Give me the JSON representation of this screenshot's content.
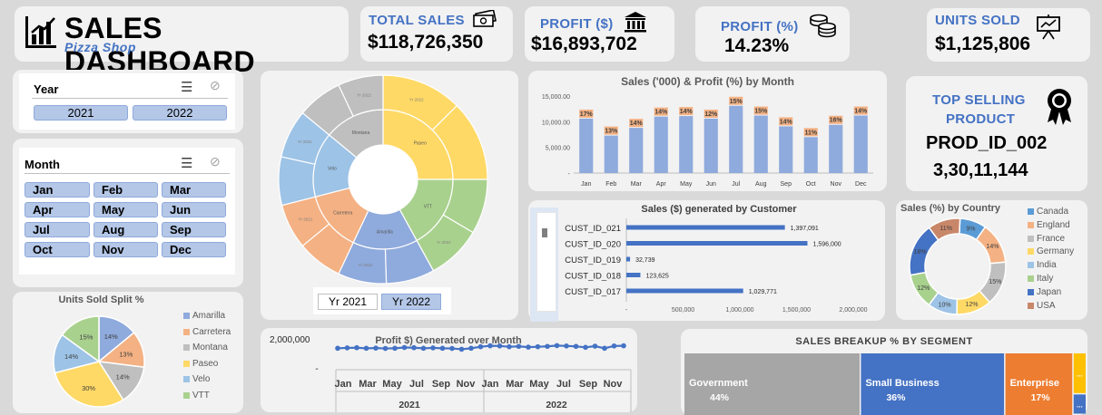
{
  "title": {
    "main": "SALES DASHBOARD",
    "sub": "Pizza Shop"
  },
  "kpis": {
    "total_sales": {
      "label": "TOTAL SALES",
      "value": "$118,726,350"
    },
    "profit_usd": {
      "label": "PROFIT ($)",
      "value": "$16,893,702"
    },
    "profit_pct": {
      "label": "PROFIT (%)",
      "value": "14.23%"
    },
    "units_sold": {
      "label": "UNITS SOLD",
      "value": "$1,125,806"
    }
  },
  "year_slicer": {
    "title": "Year",
    "items": [
      "2021",
      "2022"
    ]
  },
  "month_slicer": {
    "title": "Month",
    "items": [
      "Jan",
      "Feb",
      "Mar",
      "Apr",
      "May",
      "Jun",
      "Jul",
      "Aug",
      "Sep",
      "Oct",
      "Nov",
      "Dec"
    ]
  },
  "sunburst": {
    "yr_buttons": [
      "Yr 2021",
      "Yr 2022"
    ]
  },
  "top_product": {
    "label_line1": "TOP SELLING",
    "label_line2": "PRODUCT",
    "id": "PROD_ID_002",
    "value": "3,30,11,144"
  },
  "colors": {
    "blue": "#4472c4",
    "bar": "#8faadc",
    "orange": "#f4b183",
    "card": "#f2f2f2"
  },
  "chart_data": [
    {
      "id": "sales_profit_month",
      "type": "bar",
      "title": "Sales ('000) & Profit (%) by Month",
      "categories": [
        "Jan",
        "Feb",
        "Mar",
        "Apr",
        "May",
        "Jun",
        "Jul",
        "Aug",
        "Sep",
        "Oct",
        "Nov",
        "Dec"
      ],
      "series": [
        {
          "values": [
            10600,
            7300,
            8800,
            11000,
            11100,
            10600,
            13100,
            11200,
            9100,
            7000,
            9400,
            11200
          ]
        },
        {
          "values": [
            17,
            13,
            14,
            14,
            14,
            12,
            15,
            15,
            14,
            11,
            16,
            14
          ],
          "labels": [
            "17%",
            "13%",
            "14%",
            "14%",
            "14%",
            "12%",
            "15%",
            "15%",
            "14%",
            "11%",
            "16%",
            "14%"
          ]
        }
      ],
      "y_ticks": [
        "15,000.00",
        "10,000.00",
        "5,000.00",
        "-"
      ],
      "ylim": [
        0,
        15000
      ]
    },
    {
      "id": "sales_by_customer",
      "type": "bar",
      "orientation": "horizontal",
      "title": "Sales ($) generated by Customer",
      "categories": [
        "CUST_ID_021",
        "CUST_ID_020",
        "CUST_ID_019",
        "CUST_ID_018",
        "CUST_ID_017"
      ],
      "values": [
        1397091,
        1596000,
        32739,
        123625,
        1029771
      ],
      "value_labels": [
        "1,397,091",
        "1,596,000",
        "32,739",
        "123,625",
        "1,029,771"
      ],
      "x_ticks": [
        "-",
        "500,000",
        "1,000,000",
        "1,500,000",
        "2,000,000"
      ],
      "xlim": [
        0,
        2000000
      ]
    },
    {
      "id": "sales_by_country",
      "type": "pie",
      "title": "Sales (%) by Country",
      "categories": [
        "Canada",
        "England",
        "France",
        "Germany",
        "India",
        "Italy",
        "Japan",
        "USA"
      ],
      "values": [
        9,
        14,
        15,
        12,
        10,
        12,
        18,
        11
      ],
      "labels": [
        "9%",
        "14%",
        "15%",
        "12%",
        "10%",
        "12%",
        "18%",
        "11%"
      ],
      "colors": [
        "#5b9bd5",
        "#f4b183",
        "#bfbfbf",
        "#ffd966",
        "#9dc3e6",
        "#a9d18e",
        "#4472c4",
        "#c9876a"
      ]
    },
    {
      "id": "units_sold_split",
      "type": "pie",
      "title": "Units Sold Split %",
      "categories": [
        "Amarilla",
        "Carretera",
        "Montana",
        "Paseo",
        "Velo",
        "VTT"
      ],
      "values": [
        14,
        13,
        14,
        30,
        14,
        15
      ],
      "labels": [
        "14%",
        "13%",
        "14%",
        "30%",
        "14%",
        "15%"
      ],
      "colors": [
        "#8faadc",
        "#f4b183",
        "#bfbfbf",
        "#ffd966",
        "#9dc3e6",
        "#a9d18e"
      ]
    },
    {
      "id": "profit_over_month",
      "type": "line",
      "title": "Profit $) Generated over Month",
      "x_month_ticks": [
        "Jan",
        "Mar",
        "May",
        "Jul",
        "Sep",
        "Nov",
        "Jan",
        "Mar",
        "May",
        "Jul",
        "Sep",
        "Nov"
      ],
      "x_years": [
        "2021",
        "2022"
      ],
      "y_ticks": [
        "2,000,000",
        "-"
      ],
      "values": [
        560,
        570,
        575,
        560,
        565,
        555,
        560,
        580,
        575,
        560,
        570,
        560,
        555,
        535,
        560,
        600,
        625,
        620,
        600,
        610,
        590,
        600,
        610,
        630,
        620,
        610,
        585,
        615,
        560,
        620,
        625
      ],
      "ylim": [
        0,
        900
      ]
    },
    {
      "id": "sales_breakup_segment",
      "type": "bar",
      "title": "SALES BREAKUP % BY SEGMENT",
      "categories": [
        "Government",
        "Small Business",
        "Enterprise",
        "",
        ""
      ],
      "values": [
        44,
        36,
        17,
        2,
        1
      ],
      "labels": [
        "44%",
        "36%",
        "17%",
        "...",
        "..."
      ],
      "colors": [
        "#a6a6a6",
        "#4472c4",
        "#ed7d31",
        "#ffc000",
        "#4472c4"
      ]
    },
    {
      "id": "sunburst",
      "type": "pie",
      "subtype": "sunburst",
      "outer_labels": [
        "Yr 2022\nYr 2021",
        "Paseo",
        "VTT",
        "Yr 2022\nYr 2021",
        "Amarilla",
        "Yr 2022",
        "Carretera",
        "Yr 2021",
        "Velo",
        "Yr 2021",
        "Montana",
        "Yr 2022"
      ],
      "inner_categories": [
        "Paseo",
        "VTT",
        "Amarilla",
        "Carretera",
        "Velo",
        "Montana"
      ],
      "inner_values": [
        25,
        17,
        15,
        14,
        15,
        14
      ],
      "colors": [
        "#ffd966",
        "#a9d18e",
        "#8faadc",
        "#f4b183",
        "#9dc3e6",
        "#bfbfbf"
      ]
    }
  ]
}
